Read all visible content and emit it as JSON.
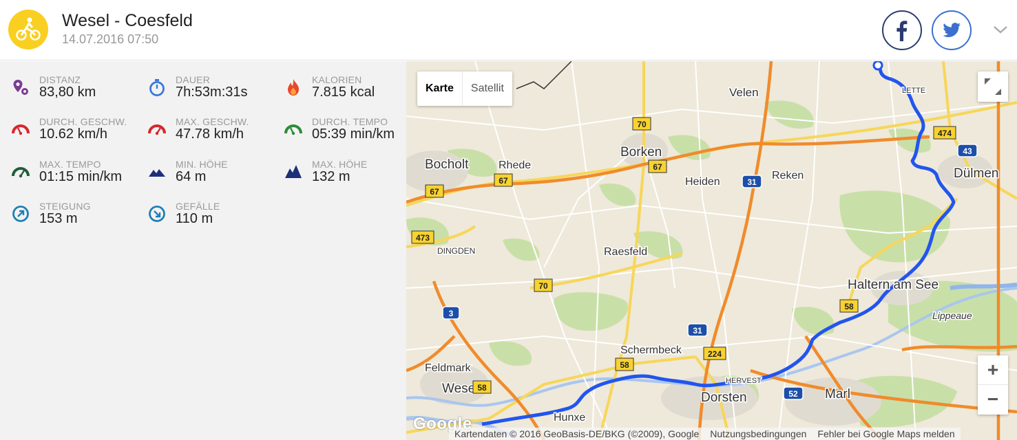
{
  "header": {
    "title": "Wesel - Coesfeld",
    "datetime": "14.07.2016 07:50",
    "activity_icon": "bicycle-icon",
    "activity_color": "#f9cf21"
  },
  "social": {
    "facebook_icon": "facebook-icon",
    "twitter_icon": "twitter-icon"
  },
  "stats": [
    {
      "name": "distance",
      "icon": "distance-pin-icon",
      "label": "DISTANZ",
      "value": "83,80 km"
    },
    {
      "name": "duration",
      "icon": "stopwatch-icon",
      "label": "DAUER",
      "value": "7h:53m:31s"
    },
    {
      "name": "calories",
      "icon": "flame-icon",
      "label": "KALORIEN",
      "value": "7.815 kcal"
    },
    {
      "name": "avg-speed",
      "icon": "speedometer-red-icon",
      "label": "DURCH. GESCHW.",
      "value": "10.62 km/h"
    },
    {
      "name": "max-speed",
      "icon": "speedometer-red-icon",
      "label": "MAX. GESCHW.",
      "value": "47.78 km/h"
    },
    {
      "name": "avg-pace",
      "icon": "speedometer-green-icon",
      "label": "DURCH. TEMPO",
      "value": "05:39 min/km"
    },
    {
      "name": "max-pace",
      "icon": "speedometer-darkgreen-icon",
      "label": "MAX. TEMPO",
      "value": "01:15 min/km"
    },
    {
      "name": "min-altitude",
      "icon": "mountain-low-icon",
      "label": "MIN. HÖHE",
      "value": "64 m"
    },
    {
      "name": "max-altitude",
      "icon": "mountain-high-icon",
      "label": "MAX. HÖHE",
      "value": "132 m"
    },
    {
      "name": "ascent",
      "icon": "arrow-up-circle-icon",
      "label": "STEIGUNG",
      "value": "153 m"
    },
    {
      "name": "descent",
      "icon": "arrow-down-circle-icon",
      "label": "GEFÄLLE",
      "value": "110 m"
    }
  ],
  "map": {
    "type_active": "Karte",
    "type_inactive": "Satellit",
    "zoom_in": "+",
    "zoom_out": "−",
    "logo": "Google",
    "attribution": "Kartendaten © 2016 GeoBasis-DE/BKG (©2009), Google",
    "terms": "Nutzungsbedingungen",
    "report": "Fehler bei Google Maps melden",
    "route_color": "#2255ee",
    "places": [
      {
        "name": "Velen",
        "major": false
      },
      {
        "name": "Borken",
        "major": true
      },
      {
        "name": "Bocholt",
        "major": true
      },
      {
        "name": "Rhede",
        "major": false
      },
      {
        "name": "Heiden",
        "major": false
      },
      {
        "name": "Reken",
        "major": false
      },
      {
        "name": "Dülmen",
        "major": true
      },
      {
        "name": "DINGDEN",
        "major": false
      },
      {
        "name": "Raesfeld",
        "major": false
      },
      {
        "name": "Haltern am See",
        "major": true
      },
      {
        "name": "Lippeaue",
        "major": false
      },
      {
        "name": "Schermbeck",
        "major": false
      },
      {
        "name": "Feldmark",
        "major": false
      },
      {
        "name": "Wesel",
        "major": true
      },
      {
        "name": "Hunxe",
        "major": false
      },
      {
        "name": "Dorsten",
        "major": true
      },
      {
        "name": "Marl",
        "major": true
      },
      {
        "name": "LETTE",
        "major": false
      },
      {
        "name": "HERVEST",
        "major": false
      }
    ],
    "road_shields": [
      {
        "label": "70",
        "kind": "federal"
      },
      {
        "label": "67",
        "kind": "federal"
      },
      {
        "label": "67",
        "kind": "federal"
      },
      {
        "label": "67",
        "kind": "federal"
      },
      {
        "label": "473",
        "kind": "federal"
      },
      {
        "label": "70",
        "kind": "federal"
      },
      {
        "label": "58",
        "kind": "federal"
      },
      {
        "label": "58",
        "kind": "federal"
      },
      {
        "label": "58",
        "kind": "federal"
      },
      {
        "label": "224",
        "kind": "federal"
      },
      {
        "label": "474",
        "kind": "federal"
      },
      {
        "label": "31",
        "kind": "autobahn"
      },
      {
        "label": "31",
        "kind": "autobahn"
      },
      {
        "label": "3",
        "kind": "autobahn"
      },
      {
        "label": "43",
        "kind": "autobahn"
      },
      {
        "label": "52",
        "kind": "autobahn"
      }
    ]
  }
}
